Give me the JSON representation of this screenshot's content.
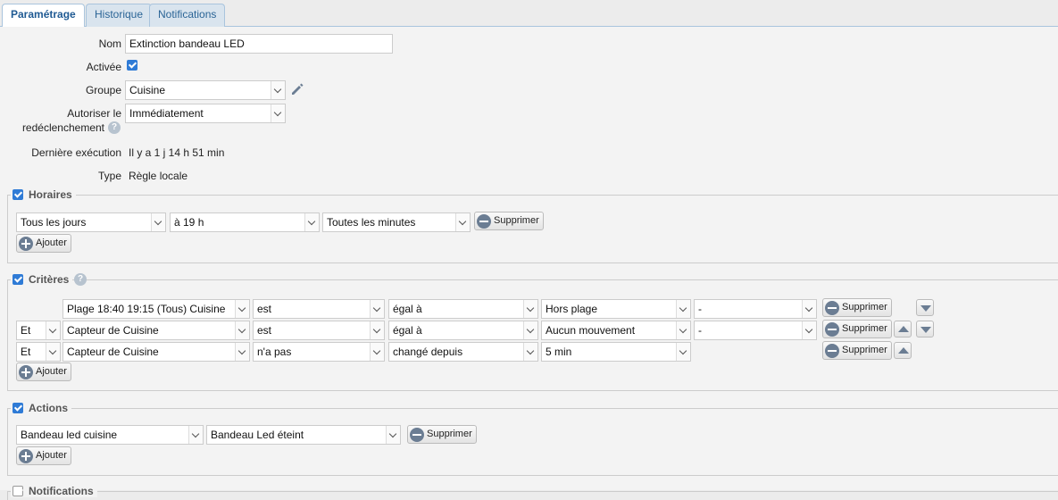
{
  "tabs": [
    "Paramétrage",
    "Historique",
    "Notifications"
  ],
  "form": {
    "nom_label": "Nom",
    "nom_value": "Extinction bandeau LED",
    "activee_label": "Activée",
    "groupe_label": "Groupe",
    "groupe_value": "Cuisine",
    "autoriser_label_1": "Autoriser le",
    "autoriser_label_2": "redéclenchement",
    "autoriser_value": "Immédiatement",
    "derniere_label": "Dernière exécution",
    "derniere_value": "Il y a 1 j 14 h 51 min",
    "type_label": "Type",
    "type_value": "Règle locale"
  },
  "horaires": {
    "legend": "Horaires",
    "row": [
      "Tous les jours",
      "à 19 h",
      "Toutes les minutes"
    ],
    "delete_label": "Supprimer",
    "add_label": "Ajouter"
  },
  "criteres": {
    "legend": "Critères",
    "rows": [
      {
        "conj": "",
        "subject": "Plage 18:40 19:15 (Tous) Cuisine",
        "verb": "est",
        "op": "égal à",
        "value": "Hors plage",
        "extra": "-"
      },
      {
        "conj": "Et",
        "subject": "Capteur de Cuisine",
        "verb": "est",
        "op": "égal à",
        "value": "Aucun mouvement",
        "extra": "-"
      },
      {
        "conj": "Et",
        "subject": "Capteur de Cuisine",
        "verb": "n'a pas",
        "op": "changé depuis",
        "value": "5 min",
        "extra": ""
      }
    ],
    "delete_label": "Supprimer",
    "add_label": "Ajouter"
  },
  "actions": {
    "legend": "Actions",
    "row": [
      "Bandeau led cuisine",
      "Bandeau Led éteint"
    ],
    "delete_label": "Supprimer",
    "add_label": "Ajouter"
  },
  "notifications_legend": "Notifications"
}
